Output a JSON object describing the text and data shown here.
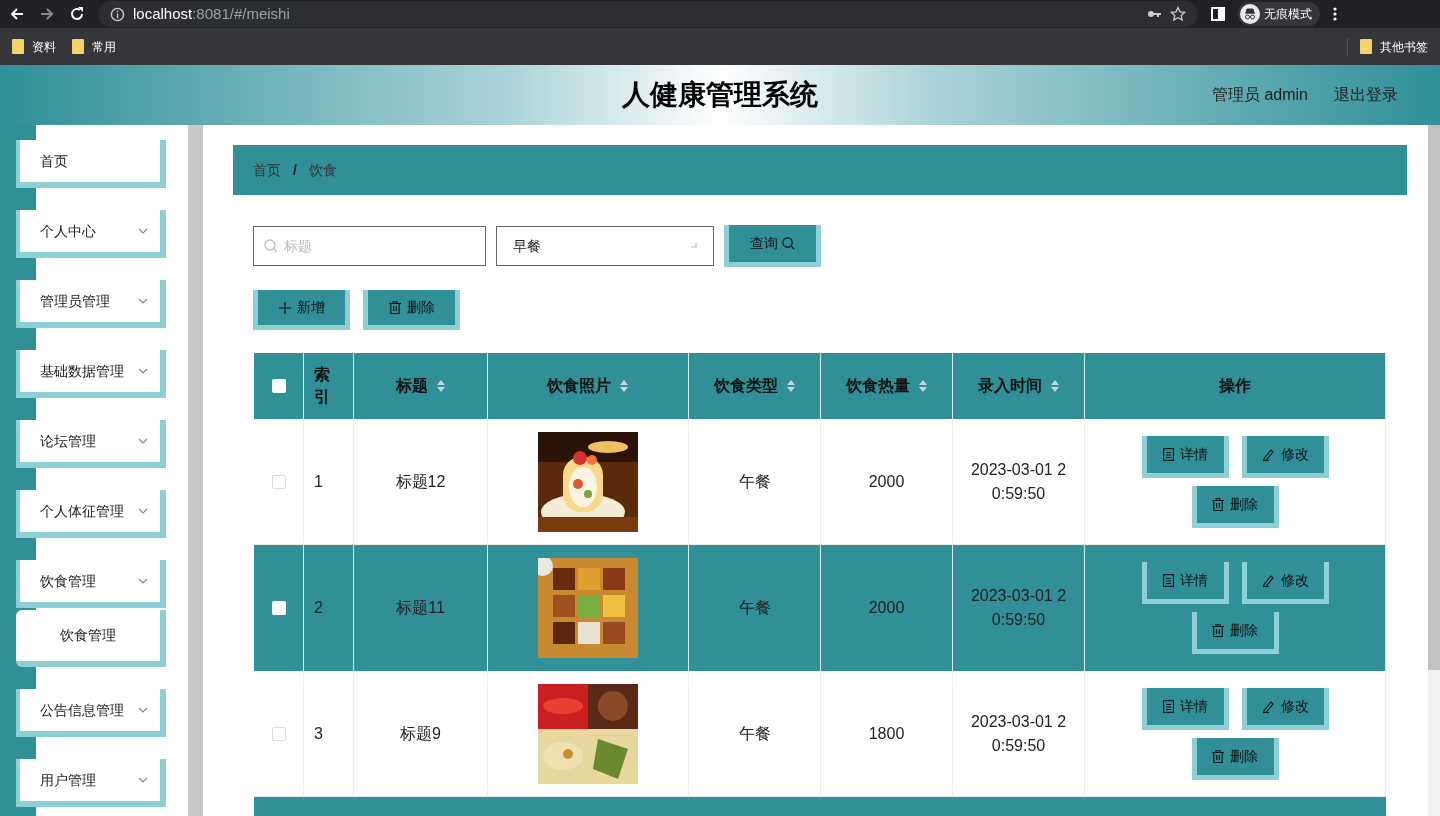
{
  "browser": {
    "url_host": "localhost",
    "url_path": ":8081/#/meishi",
    "profile": "无痕模式",
    "bookmarks": [
      "资料",
      "常用"
    ],
    "other_bookmarks": "其他书签"
  },
  "header": {
    "title": "人健康管理系统",
    "user": "管理员 admin",
    "logout": "退出登录"
  },
  "sidebar": {
    "items": [
      {
        "label": "首页",
        "kind": "link"
      },
      {
        "label": "个人中心",
        "kind": "menu",
        "expanded": false
      },
      {
        "label": "管理员管理",
        "kind": "menu",
        "expanded": false
      },
      {
        "label": "基础数据管理",
        "kind": "menu",
        "expanded": false
      },
      {
        "label": "论坛管理",
        "kind": "menu",
        "expanded": false
      },
      {
        "label": "个人体征管理",
        "kind": "menu",
        "expanded": false
      },
      {
        "label": "饮食管理",
        "kind": "menu",
        "expanded": true,
        "children": [
          {
            "label": "饮食管理"
          }
        ]
      },
      {
        "label": "公告信息管理",
        "kind": "menu",
        "expanded": false
      },
      {
        "label": "用户管理",
        "kind": "menu",
        "expanded": false
      }
    ]
  },
  "breadcrumb": {
    "separator": "/",
    "items": [
      "首页",
      "饮食"
    ]
  },
  "filters": {
    "search": {
      "placeholder": "标题"
    },
    "select": {
      "value": "早餐"
    },
    "query_button": "查询"
  },
  "actions": [
    {
      "kind": "add",
      "label": "新增"
    },
    {
      "kind": "delete",
      "label": "删除"
    }
  ],
  "table": {
    "columns": [
      {
        "kind": "checkbox",
        "checked": false
      },
      {
        "label": "索引",
        "sortable": false
      },
      {
        "label": "标题",
        "sortable": true
      },
      {
        "label": "饮食照片",
        "sortable": true
      },
      {
        "label": "饮食类型",
        "sortable": true
      },
      {
        "label": "饮食热量",
        "sortable": true
      },
      {
        "label": "录入时间",
        "sortable": true
      },
      {
        "label": "操作",
        "sortable": false
      }
    ],
    "rows": [
      {
        "checked": false,
        "index": "1",
        "title": "标题12",
        "type": "午餐",
        "calories": "2000",
        "time": "2023-03-01 20:59:50",
        "actions": [
          {
            "kind": "detail",
            "label": "详情"
          },
          {
            "kind": "edit",
            "label": "修改"
          },
          {
            "kind": "delete",
            "label": "删除"
          }
        ]
      },
      {
        "checked": false,
        "index": "2",
        "title": "标题11",
        "type": "午餐",
        "calories": "2000",
        "time": "2023-03-01 20:59:50",
        "actions": [
          {
            "kind": "detail",
            "label": "详情"
          },
          {
            "kind": "edit",
            "label": "修改"
          },
          {
            "kind": "delete",
            "label": "删除"
          }
        ]
      },
      {
        "checked": false,
        "index": "3",
        "title": "标题9",
        "type": "午餐",
        "calories": "1800",
        "time": "2023-03-01 20:59:50",
        "actions": [
          {
            "kind": "detail",
            "label": "详情"
          },
          {
            "kind": "edit",
            "label": "修改"
          },
          {
            "kind": "delete",
            "label": "删除"
          }
        ]
      }
    ]
  }
}
